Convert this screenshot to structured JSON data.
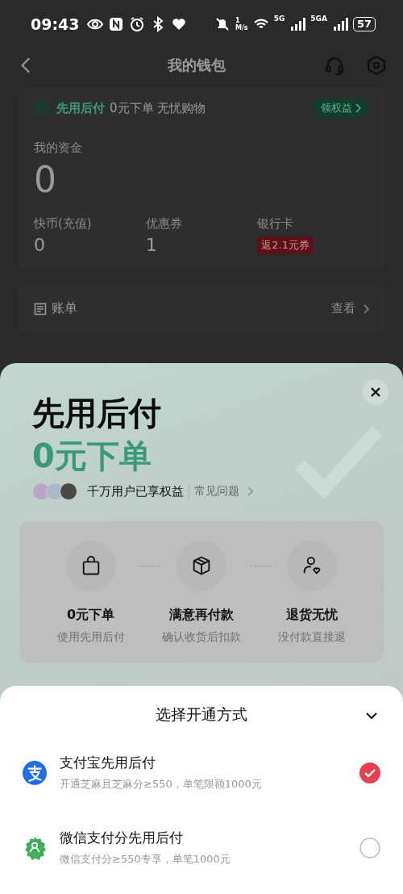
{
  "status_bar": {
    "time": "09:43",
    "speed_value": "1",
    "speed_unit": "M/s",
    "network_1": "5G",
    "network_2": "5GA",
    "battery": "57"
  },
  "nav": {
    "title": "我的钱包"
  },
  "promo": {
    "badge": "先用后付",
    "text": "0元下单 无忧购物",
    "button": "领权益"
  },
  "funds": {
    "label": "我的资金",
    "value": "0"
  },
  "stats": [
    {
      "kind": "number",
      "label": "快币(充值)",
      "value": "0"
    },
    {
      "kind": "number",
      "label": "优惠券",
      "value": "1"
    },
    {
      "kind": "tag",
      "label": "银行卡",
      "value": "返2.1元券"
    }
  ],
  "bill": {
    "label": "账单",
    "link": "查看"
  },
  "sheet": {
    "title": "先用后付",
    "headline": "0元下单",
    "users_text": "千万用户已享权益",
    "faq": "常见问题",
    "features": [
      {
        "kind": "bag",
        "title": "0元下单",
        "subtitle": "使用先用后付"
      },
      {
        "kind": "box",
        "title": "满意再付款",
        "subtitle": "确认收货后扣款"
      },
      {
        "kind": "person",
        "title": "退货无忧",
        "subtitle": "没付款直接退"
      }
    ]
  },
  "method_panel": {
    "title": "选择开通方式",
    "options": [
      {
        "kind": "alipay",
        "name": "支付宝先用后付",
        "desc": "开通芝麻且芝麻分≥550，单笔限额1000元",
        "selected": true
      },
      {
        "kind": "wechat",
        "name": "微信支付分先用后付",
        "desc": "微信支付分≥550专享，单笔1000元",
        "selected": false
      }
    ]
  }
}
